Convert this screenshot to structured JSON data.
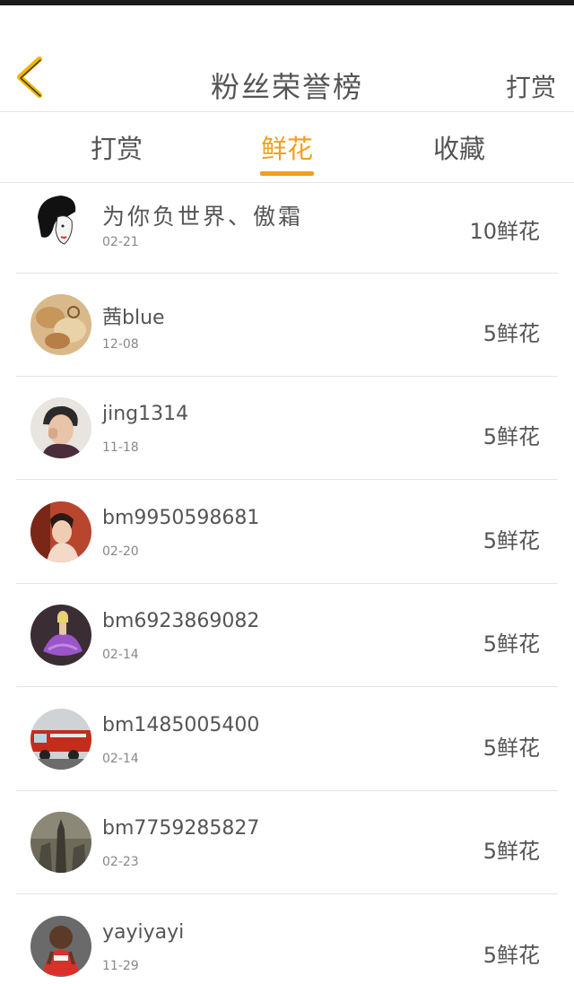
{
  "header": {
    "title": "粉丝荣誉榜",
    "action": "打赏",
    "back_icon": "chevron-left-icon",
    "back_color": "#f0b400"
  },
  "tabs": [
    {
      "label": "打赏",
      "active": false
    },
    {
      "label": "鲜花",
      "active": true
    },
    {
      "label": "收藏",
      "active": false
    }
  ],
  "accent": "#f0a020",
  "rows": [
    {
      "name": "为你负世界、傲霜",
      "date": "02-21",
      "amount": "10鲜花",
      "avatar": "sketch-girl"
    },
    {
      "name": "茜blue",
      "date": "12-08",
      "amount": "5鲜花",
      "avatar": "food"
    },
    {
      "name": "jing1314",
      "date": "11-18",
      "amount": "5鲜花",
      "avatar": "man"
    },
    {
      "name": "bm9950598681",
      "date": "02-20",
      "amount": "5鲜花",
      "avatar": "woman-red"
    },
    {
      "name": "bm6923869082",
      "date": "02-14",
      "amount": "5鲜花",
      "avatar": "purple-dress"
    },
    {
      "name": "bm1485005400",
      "date": "02-14",
      "amount": "5鲜花",
      "avatar": "fire-truck"
    },
    {
      "name": "bm7759285827",
      "date": "02-23",
      "amount": "5鲜花",
      "avatar": "tower"
    },
    {
      "name": "yayiyayi",
      "date": "11-29",
      "amount": "5鲜花",
      "avatar": "cartoon"
    }
  ]
}
